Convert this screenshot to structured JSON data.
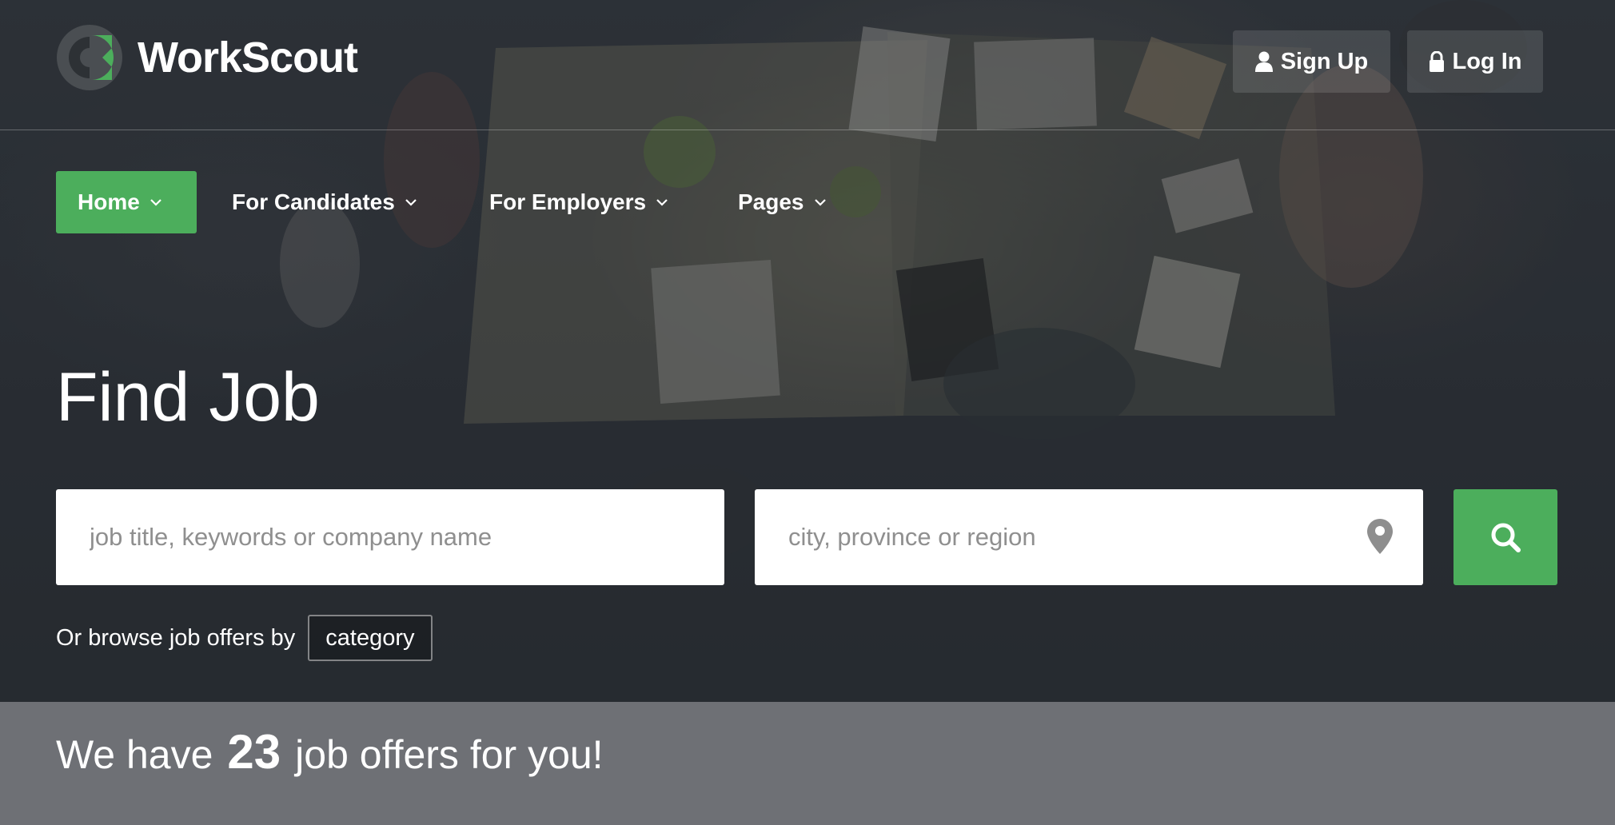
{
  "brand": {
    "name": "WorkScout",
    "accent": "#4cae5c",
    "logo_icon": "workscout-logo-icon"
  },
  "header": {
    "signup_label": "Sign Up",
    "login_label": "Log In"
  },
  "nav": {
    "items": [
      {
        "label": "Home",
        "active": true
      },
      {
        "label": "For Candidates",
        "active": false
      },
      {
        "label": "For Employers",
        "active": false
      },
      {
        "label": "Pages",
        "active": false
      }
    ]
  },
  "hero": {
    "title": "Find Job",
    "keyword_placeholder": "job title, keywords or company name",
    "location_placeholder": "city, province or region",
    "browse_text": "Or browse job offers by",
    "category_label": "category"
  },
  "offers": {
    "prefix": "We have",
    "count": "23",
    "suffix": "job offers for you!"
  }
}
